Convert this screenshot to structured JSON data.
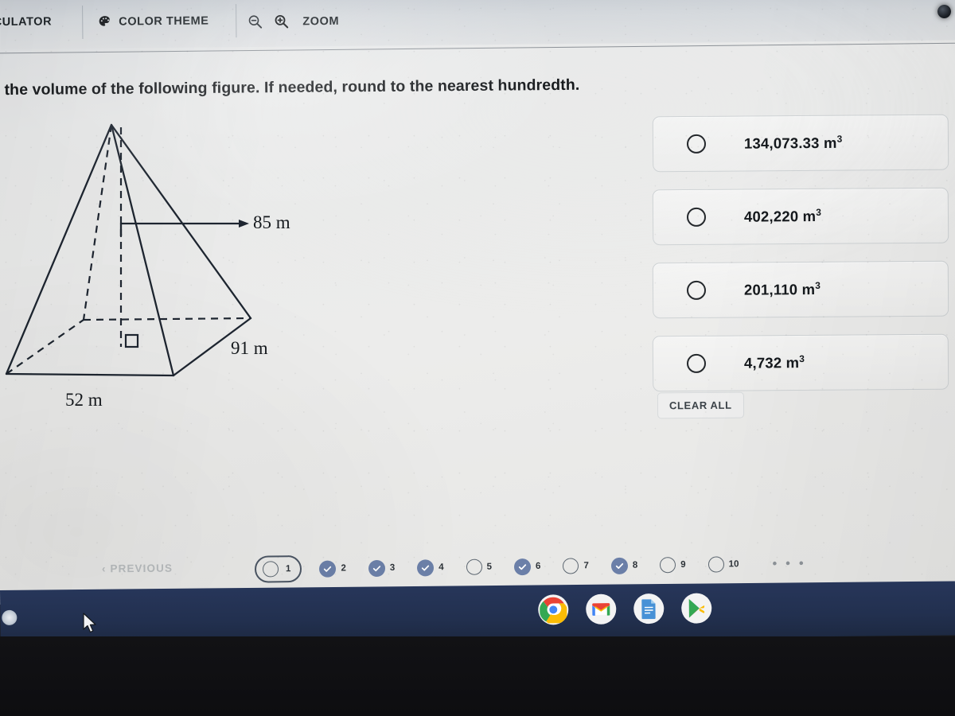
{
  "toolbar": {
    "calculator_label": "LCULATOR",
    "color_theme_label": "COLOR THEME",
    "zoom_label": "ZOOM",
    "palette_icon": "palette-icon",
    "zoom_out_icon": "magnifier-minus-icon",
    "zoom_in_icon": "magnifier-plus-icon"
  },
  "question": {
    "prompt": "d the volume of the following figure. If needed, round to the nearest hundredth."
  },
  "figure": {
    "type": "rectangular-pyramid",
    "height_label": "85 m",
    "base_depth_label": "91 m",
    "base_width_label": "52 m",
    "right_angle_marker": "right-angle-square"
  },
  "answers": {
    "options": [
      {
        "id": "option-1",
        "label": "134,073.33 m",
        "exponent": "3",
        "selected": false
      },
      {
        "id": "option-2",
        "label": "402,220 m",
        "exponent": "3",
        "selected": false
      },
      {
        "id": "option-3",
        "label": "201,110 m",
        "exponent": "3",
        "selected": false
      },
      {
        "id": "option-4",
        "label": "4,732 m",
        "exponent": "3",
        "selected": false
      }
    ],
    "clear_all_label": "CLEAR ALL"
  },
  "pager": {
    "previous_label": "‹  PREVIOUS",
    "ellipsis": "• • •",
    "items": [
      {
        "number": "1",
        "state": "current"
      },
      {
        "number": "2",
        "state": "answered"
      },
      {
        "number": "3",
        "state": "answered"
      },
      {
        "number": "4",
        "state": "answered"
      },
      {
        "number": "5",
        "state": "empty"
      },
      {
        "number": "6",
        "state": "answered"
      },
      {
        "number": "7",
        "state": "empty"
      },
      {
        "number": "8",
        "state": "answered"
      },
      {
        "number": "9",
        "state": "empty"
      },
      {
        "number": "10",
        "state": "empty"
      }
    ]
  },
  "shelf": {
    "apps": [
      {
        "name": "chrome-icon"
      },
      {
        "name": "gmail-icon"
      },
      {
        "name": "google-docs-icon"
      },
      {
        "name": "play-store-icon"
      }
    ],
    "launcher": "launcher-button"
  },
  "colors": {
    "accent": "#6b7fa8",
    "shelf": "#22304f",
    "toolbar": "#d5d9dd",
    "page": "#ececeb",
    "ink": "#14181c"
  }
}
